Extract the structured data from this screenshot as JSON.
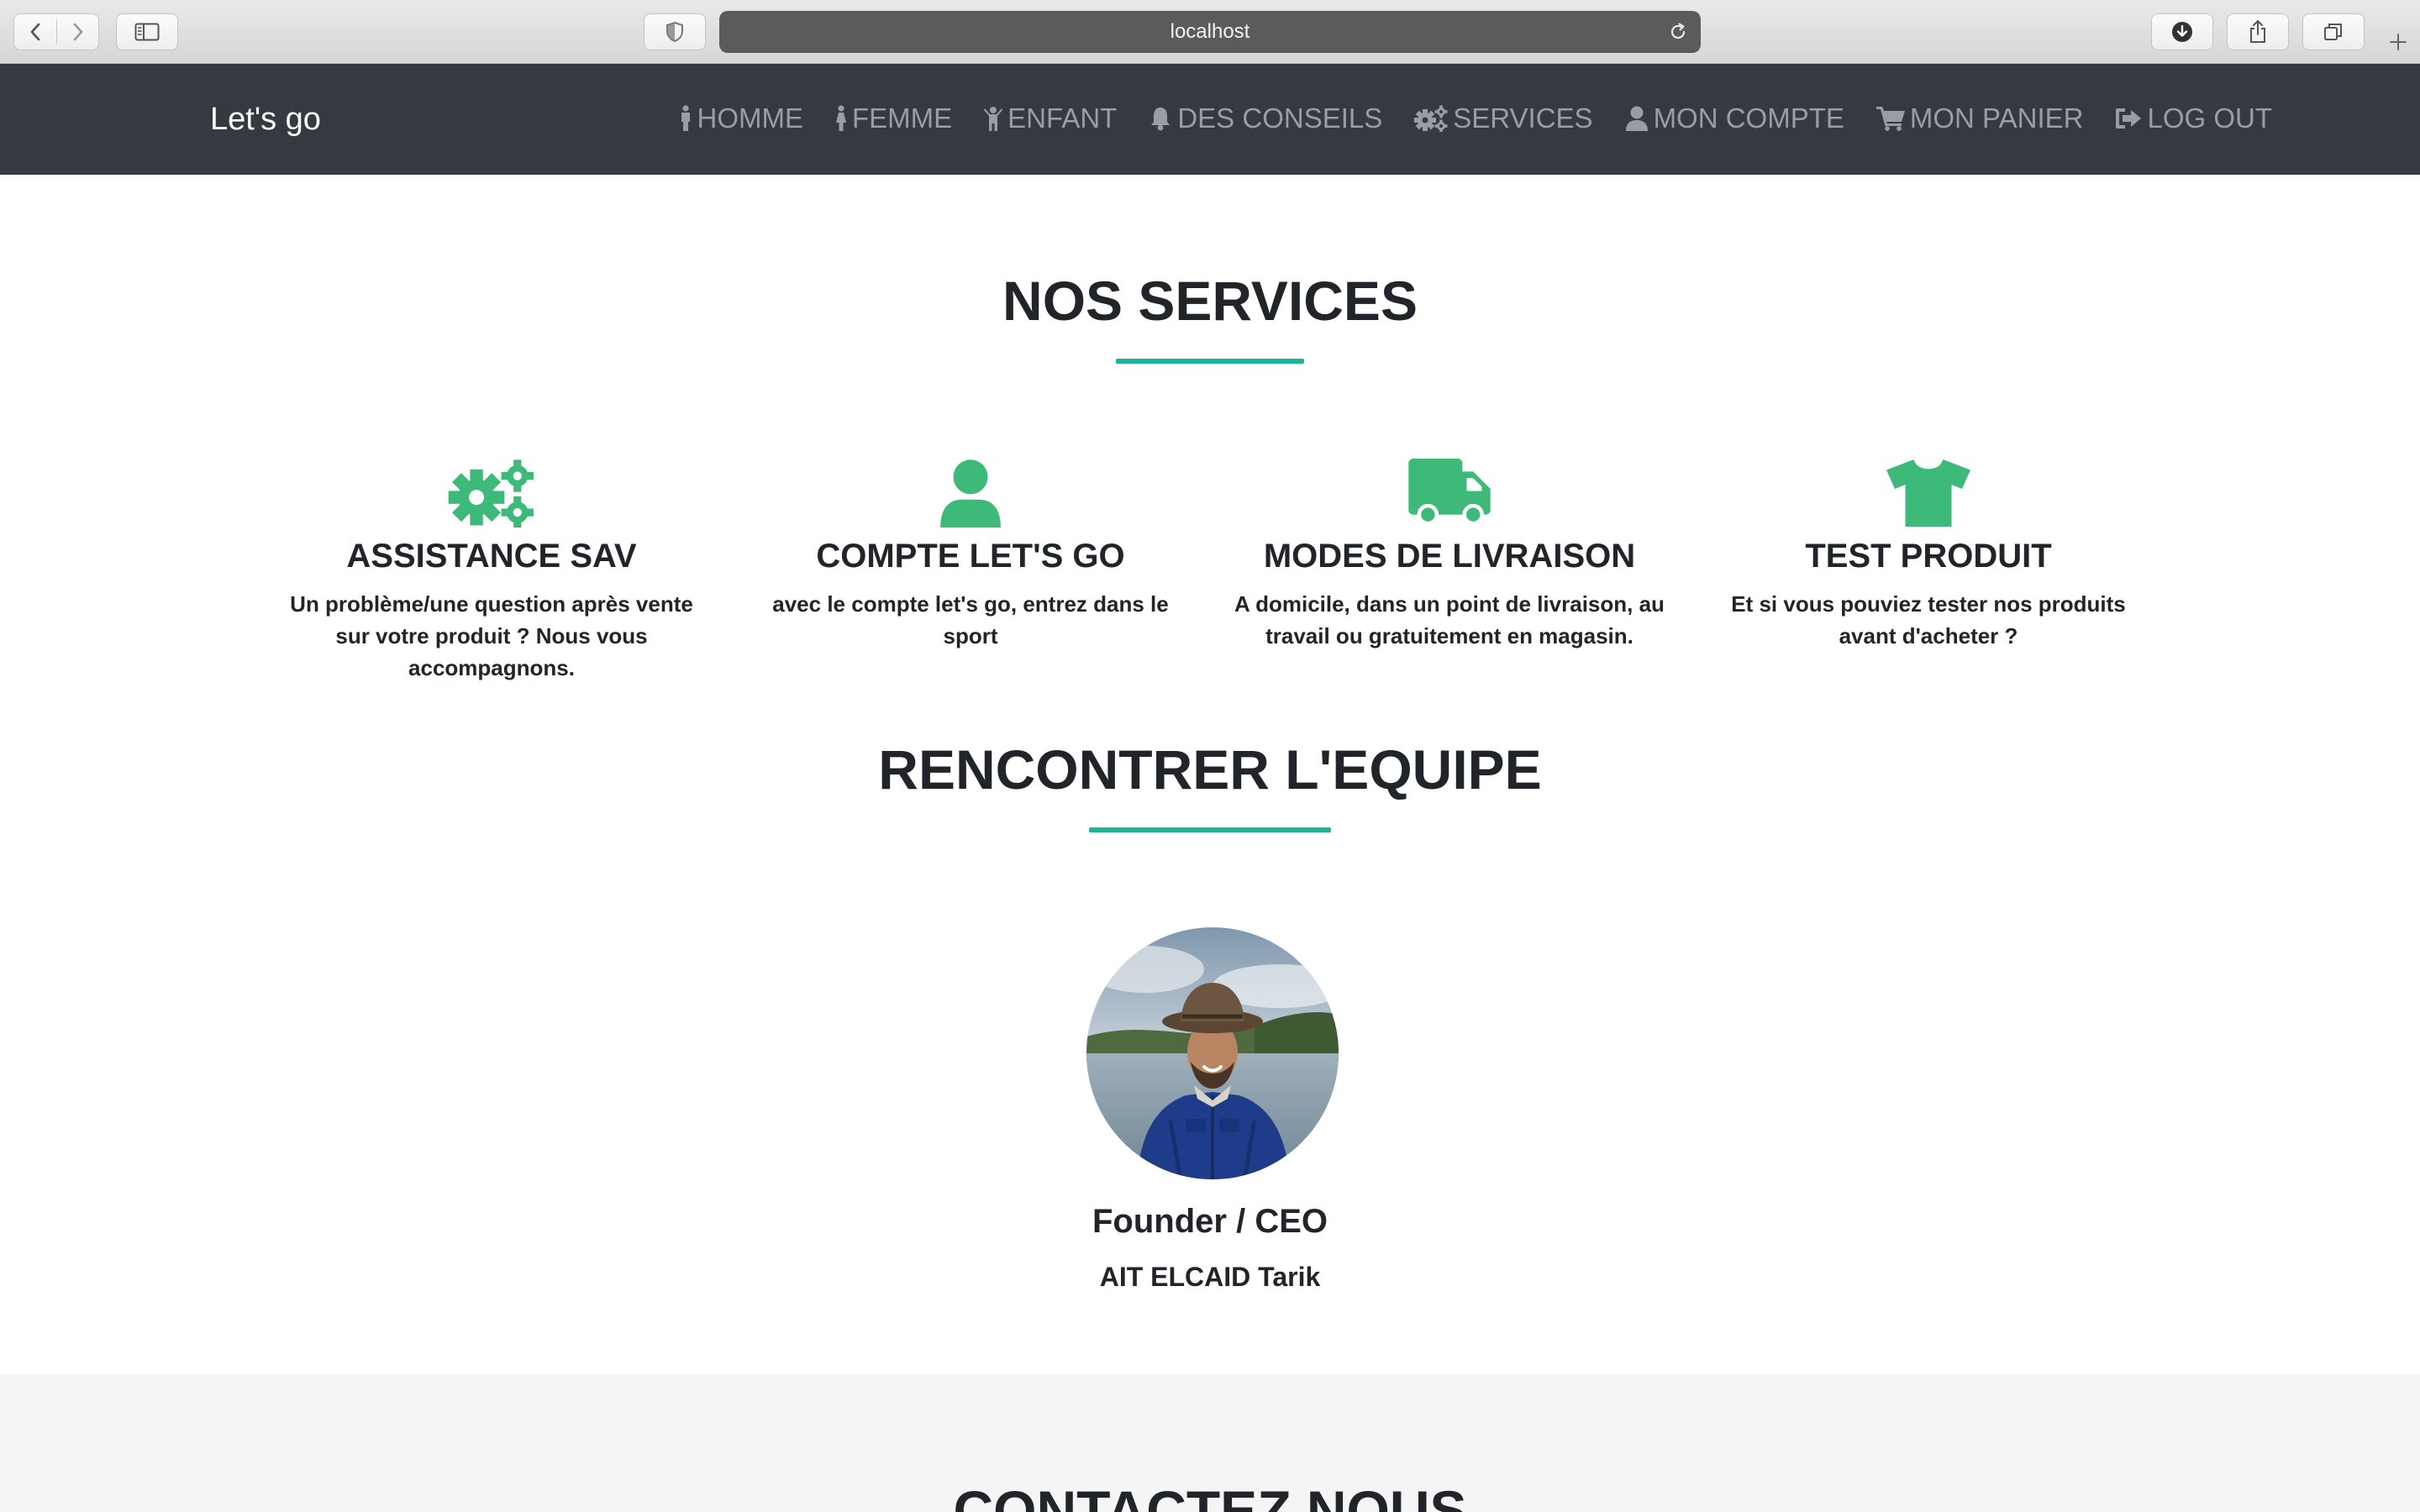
{
  "browser": {
    "url": "localhost"
  },
  "navbar": {
    "brand": "Let's go",
    "links": [
      {
        "label": "HOMME",
        "icon": "male-icon"
      },
      {
        "label": "FEMME",
        "icon": "female-icon"
      },
      {
        "label": "ENFANT",
        "icon": "child-icon"
      },
      {
        "label": "DES CONSEILS",
        "icon": "bell-icon"
      },
      {
        "label": "SERVICES",
        "icon": "cogs-icon"
      },
      {
        "label": "MON COMPTE",
        "icon": "user-icon"
      },
      {
        "label": "MON PANIER",
        "icon": "cart-icon"
      },
      {
        "label": "LOG OUT",
        "icon": "logout-icon"
      }
    ]
  },
  "services": {
    "title": "NOS SERVICES",
    "items": [
      {
        "icon": "cogs-icon",
        "title": "ASSISTANCE SAV",
        "description": "Un problème/une question après vente sur votre produit ? Nous vous accompagnons."
      },
      {
        "icon": "user-icon",
        "title": "COMPTE LET'S GO",
        "description": "avec le compte let's go, entrez dans le sport"
      },
      {
        "icon": "truck-icon",
        "title": "MODES DE LIVRAISON",
        "description": "A domicile, dans un point de livraison, au travail ou gratuitement en magasin."
      },
      {
        "icon": "tshirt-icon",
        "title": "TEST PRODUIT",
        "description": "Et si vous pouviez tester nos produits avant d'acheter ?"
      }
    ]
  },
  "team": {
    "title": "RENCONTRER L'EQUIPE",
    "member": {
      "role": "Founder / CEO",
      "name": "AIT ELCAID Tarik"
    }
  },
  "contact": {
    "title": "CONTACTEZ NOUS"
  },
  "colors": {
    "accent": "#1fb39a",
    "icon_green": "#3dba79",
    "navbar_bg": "#343a40",
    "nav_link": "#9a9da1",
    "contact_bg": "#f5f5f5"
  }
}
